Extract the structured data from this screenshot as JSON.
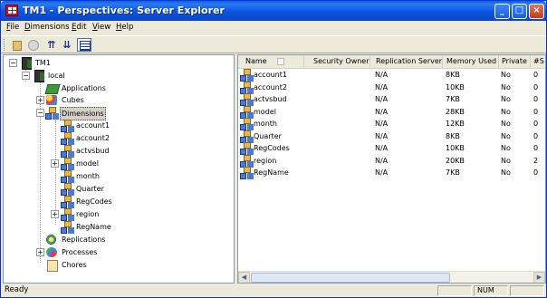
{
  "window": {
    "title": "TM1 - Perspectives: Server Explorer"
  },
  "menu": [
    {
      "label": "File",
      "key": "F",
      "rest": "ile"
    },
    {
      "label": "Dimensions",
      "key": "D",
      "rest": "imensions"
    },
    {
      "label": "Edit",
      "key": "E",
      "rest": "dit"
    },
    {
      "label": "View",
      "key": "V",
      "rest": "iew"
    },
    {
      "label": "Help",
      "key": "H",
      "rest": "elp"
    }
  ],
  "toolbar": {
    "icons": [
      "copy-icon",
      "stop-icon",
      "sort-up-icon",
      "sort-down-icon",
      "list-view-icon"
    ]
  },
  "tree": {
    "root": "TM1",
    "server": "local",
    "applications": "Applications",
    "cubes": "Cubes",
    "dimensions": "Dimensions",
    "dimension_items": [
      "account1",
      "account2",
      "actvsbud",
      "model",
      "month",
      "Quarter",
      "RegCodes",
      "region",
      "RegName"
    ],
    "replications": "Replications",
    "processes": "Processes",
    "chores": "Chores"
  },
  "list": {
    "columns": [
      "Name",
      "Security Owner",
      "Replication Server",
      "Memory Used",
      "Private",
      "#S"
    ],
    "rows": [
      {
        "name": "account1",
        "security_owner": "",
        "replication_server": "N/A",
        "memory": "8KB",
        "private": "No",
        "count": "0"
      },
      {
        "name": "account2",
        "security_owner": "",
        "replication_server": "N/A",
        "memory": "10KB",
        "private": "No",
        "count": "0"
      },
      {
        "name": "actvsbud",
        "security_owner": "",
        "replication_server": "N/A",
        "memory": "7KB",
        "private": "No",
        "count": "0"
      },
      {
        "name": "model",
        "security_owner": "",
        "replication_server": "N/A",
        "memory": "28KB",
        "private": "No",
        "count": "0"
      },
      {
        "name": "month",
        "security_owner": "",
        "replication_server": "N/A",
        "memory": "12KB",
        "private": "No",
        "count": "0"
      },
      {
        "name": "Quarter",
        "security_owner": "",
        "replication_server": "N/A",
        "memory": "8KB",
        "private": "No",
        "count": "0"
      },
      {
        "name": "RegCodes",
        "security_owner": "",
        "replication_server": "N/A",
        "memory": "10KB",
        "private": "No",
        "count": "0"
      },
      {
        "name": "region",
        "security_owner": "",
        "replication_server": "N/A",
        "memory": "20KB",
        "private": "No",
        "count": "2"
      },
      {
        "name": "RegName",
        "security_owner": "",
        "replication_server": "N/A",
        "memory": "7KB",
        "private": "No",
        "count": "0"
      }
    ]
  },
  "status": {
    "text": "Ready",
    "num": "NUM"
  },
  "colors": {
    "titlebar": "#0a54df",
    "selection": "#d4d0c8",
    "chrome": "#ece9d8"
  }
}
